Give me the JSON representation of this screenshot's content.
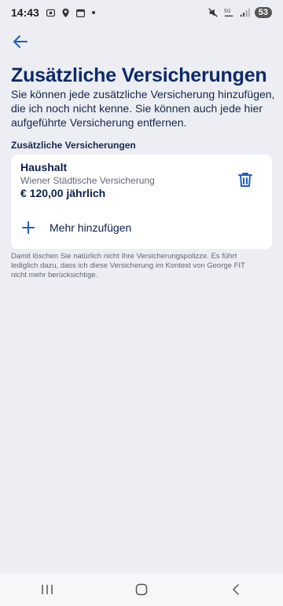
{
  "status_bar": {
    "time": "14:43",
    "battery": "53"
  },
  "header": {
    "back_icon": "arrow-left-icon",
    "title": "Zusätzliche Versicherungen",
    "description": "Sie können jede zusätzliche Versicherung hinzufügen, die ich noch nicht kenne. Sie können auch jede hier aufgeführte Versicherung entfernen."
  },
  "section": {
    "label": "Zusätzliche Versicherungen"
  },
  "insurance_items": [
    {
      "name": "Haushalt",
      "company": "Wiener Städtische Versicherung",
      "price": "€ 120,00 jährlich",
      "delete_icon": "trash-icon"
    }
  ],
  "add_more": {
    "label": "Mehr hinzufügen",
    "icon": "plus-icon"
  },
  "footnote": "Damit löschen Sie natürlich nicht Ihre Versicherungspolizze. Es führt lediglich dazu, dass ich diese Versicherung im Kontext von George FIT nicht mehr berücksichtige.",
  "colors": {
    "accent": "#1f5fbf",
    "title": "#0d2a6b",
    "background": "#eceef3"
  }
}
